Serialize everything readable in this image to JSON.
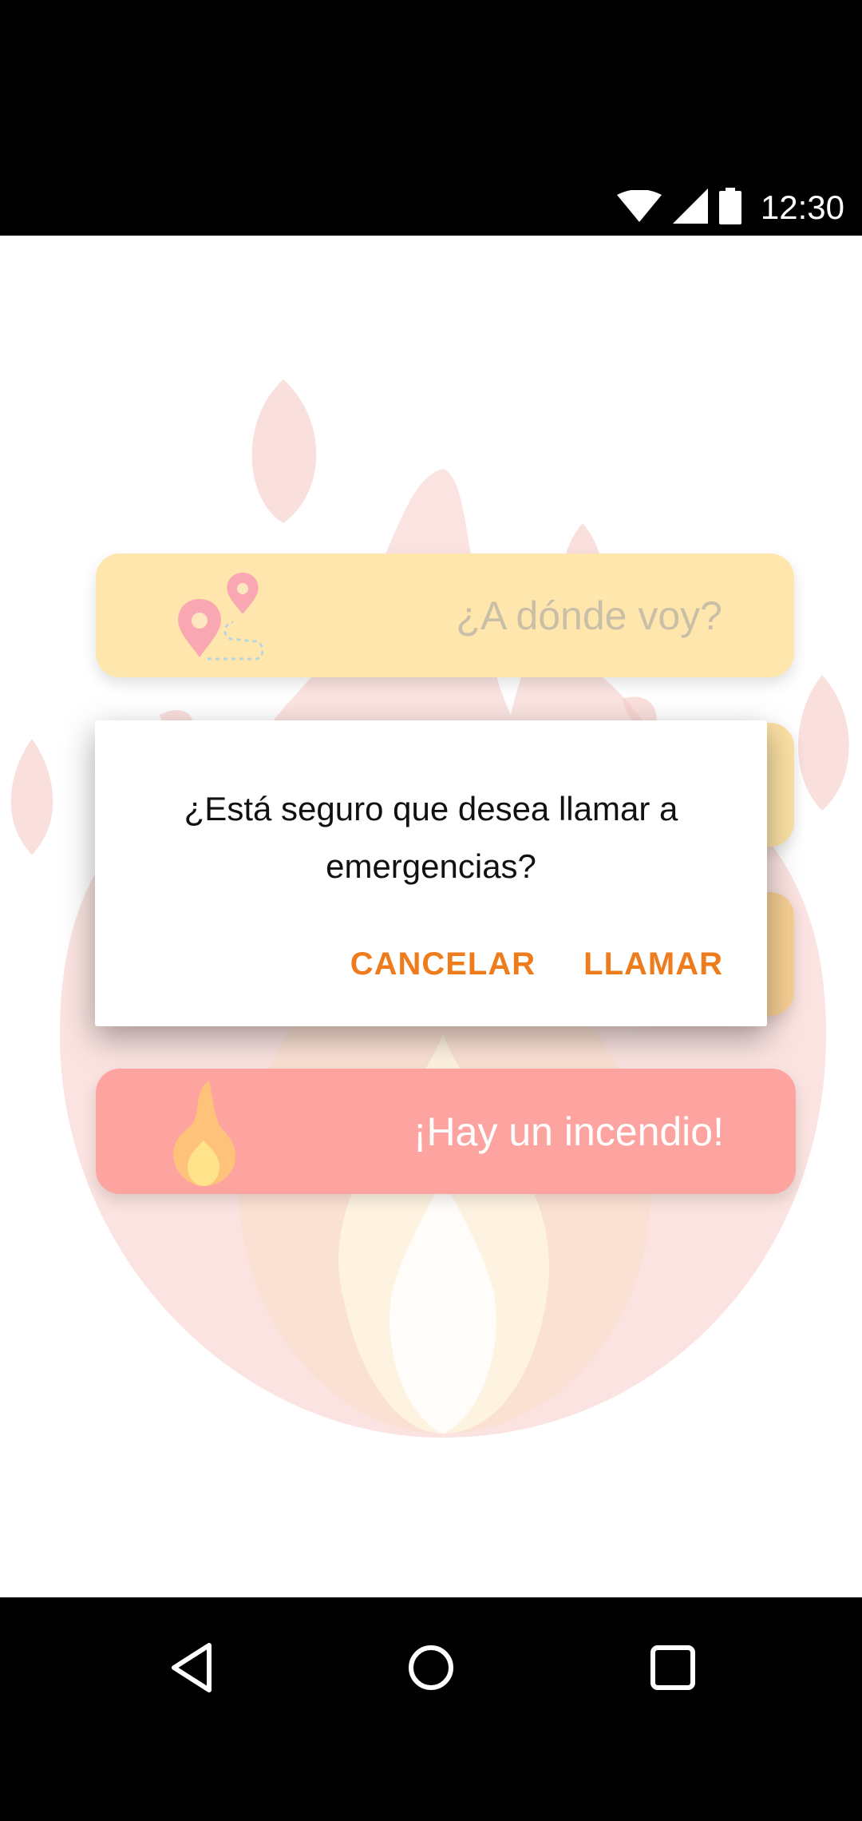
{
  "status_bar": {
    "time": "12:30",
    "icons": [
      "wifi-icon",
      "cell-signal-icon",
      "battery-icon"
    ]
  },
  "main": {
    "cards": {
      "where": {
        "label": "¿A dónde voy?",
        "icon": "route-pins-icon"
      },
      "fire": {
        "label": "¡Hay un incendio!",
        "icon": "flame-icon"
      }
    }
  },
  "dialog": {
    "message": "¿Está seguro que desea llamar a emergencias?",
    "cancel_label": "CANCELAR",
    "call_label": "LLAMAR"
  },
  "nav_bar": {
    "icons": [
      "back-icon",
      "home-icon",
      "recents-icon"
    ]
  },
  "colors": {
    "accent": "#ef7c1c",
    "card_where": "#ffe6ad",
    "card_fire": "#fea4a0"
  }
}
